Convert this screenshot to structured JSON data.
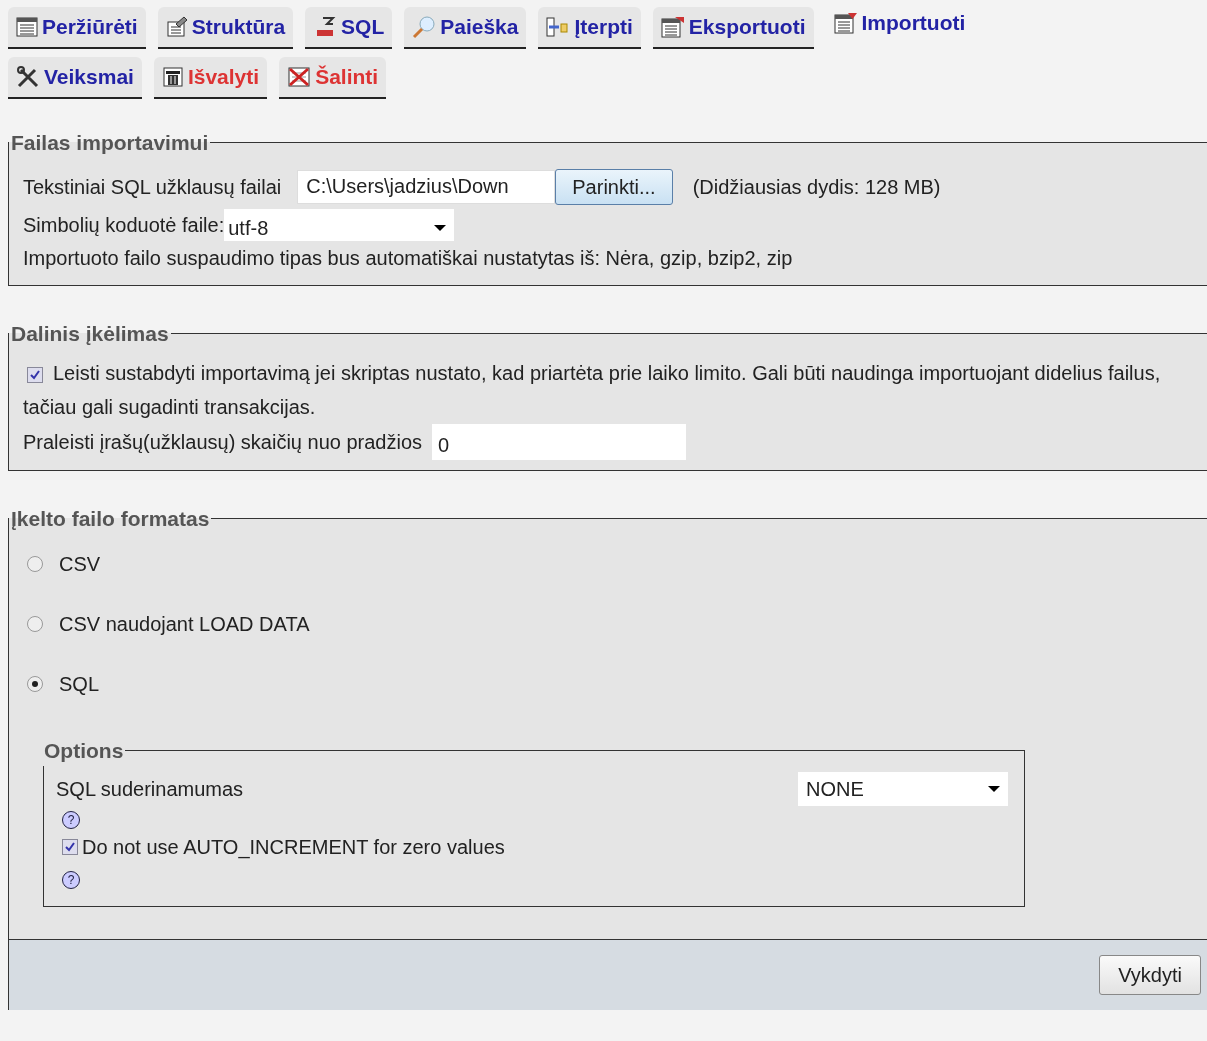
{
  "tab_rows": [
    [
      {
        "label": "Peržiūrėti",
        "selected": false,
        "kind": "normal"
      },
      {
        "label": "Struktūra",
        "selected": false,
        "kind": "normal"
      },
      {
        "label": "SQL",
        "selected": false,
        "kind": "normal"
      },
      {
        "label": "Paieška",
        "selected": false,
        "kind": "normal"
      },
      {
        "label": "Įterpti",
        "selected": false,
        "kind": "normal"
      },
      {
        "label": "Eksportuoti",
        "selected": false,
        "kind": "normal"
      },
      {
        "label": "Importuoti",
        "selected": true,
        "kind": "normal"
      }
    ],
    [
      {
        "label": "Veiksmai",
        "selected": false,
        "kind": "normal"
      },
      {
        "label": "Išvalyti",
        "selected": false,
        "kind": "danger"
      },
      {
        "label": "Šalinti",
        "selected": false,
        "kind": "danger"
      }
    ]
  ],
  "file_section": {
    "legend": "Failas importavimui",
    "file_label": "Tekstiniai SQL užklausų failai",
    "file_value": "C:\\Users\\jadzius\\Down",
    "browse_button": "Parinkti...",
    "max_size": "(Didžiausias dydis: 128 MB)",
    "charset_label": "Simbolių koduotė faile:",
    "charset_value": "utf-8",
    "compression_note": "Importuoto failo suspaudimo tipas bus automatiškai nustatytas iš: Nėra, gzip, bzip2, zip"
  },
  "partial_section": {
    "legend": "Dalinis įkėlimas",
    "allow_interrupt": {
      "label": "Leisti sustabdyti importavimą jei skriptas nustato, kad priartėta prie laiko limito. Gali būti naudinga importuojant didelius failus, tačiau gali sugadinti transakcijas.",
      "checked": true
    },
    "skip_label": "Praleisti įrašų(užklausų) skaičių nuo pradžios",
    "skip_value": "0"
  },
  "format_section": {
    "legend": "Įkelto failo formatas",
    "formats": [
      {
        "label": "CSV",
        "selected": false
      },
      {
        "label": "CSV naudojant LOAD DATA",
        "selected": false
      },
      {
        "label": "SQL",
        "selected": true
      }
    ],
    "options": {
      "legend": "Options",
      "compat_label": "SQL suderinamumas",
      "compat_value": "NONE",
      "help_marks": [
        "?",
        "?"
      ],
      "no_auto_increment": {
        "label": "Do not use AUTO_INCREMENT for zero values",
        "checked": true
      }
    }
  },
  "submit_button": "Vykdyti"
}
